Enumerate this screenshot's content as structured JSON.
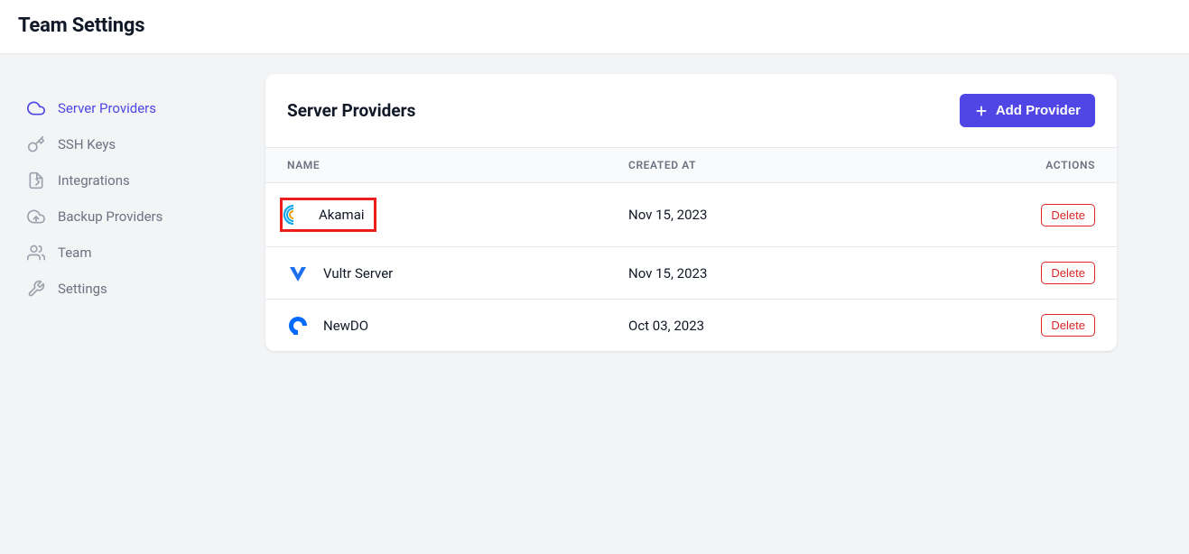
{
  "header": {
    "title": "Team Settings"
  },
  "sidebar": {
    "items": [
      {
        "label": "Server Providers",
        "icon": "cloud",
        "active": true
      },
      {
        "label": "SSH Keys",
        "icon": "key",
        "active": false
      },
      {
        "label": "Integrations",
        "icon": "integrations",
        "active": false
      },
      {
        "label": "Backup Providers",
        "icon": "cloud-up",
        "active": false
      },
      {
        "label": "Team",
        "icon": "users",
        "active": false
      },
      {
        "label": "Settings",
        "icon": "tools",
        "active": false
      }
    ]
  },
  "panel": {
    "title": "Server Providers",
    "add_button": "Add Provider",
    "columns": {
      "name": "NAME",
      "created": "CREATED AT",
      "actions": "ACTIONS"
    },
    "delete_label": "Delete",
    "rows": [
      {
        "name": "Akamai",
        "created": "Nov 15, 2023",
        "logo": "akamai",
        "highlight": true
      },
      {
        "name": "Vultr Server",
        "created": "Nov 15, 2023",
        "logo": "vultr",
        "highlight": false
      },
      {
        "name": "NewDO",
        "created": "Oct 03, 2023",
        "logo": "digitalocean",
        "highlight": false
      }
    ]
  }
}
